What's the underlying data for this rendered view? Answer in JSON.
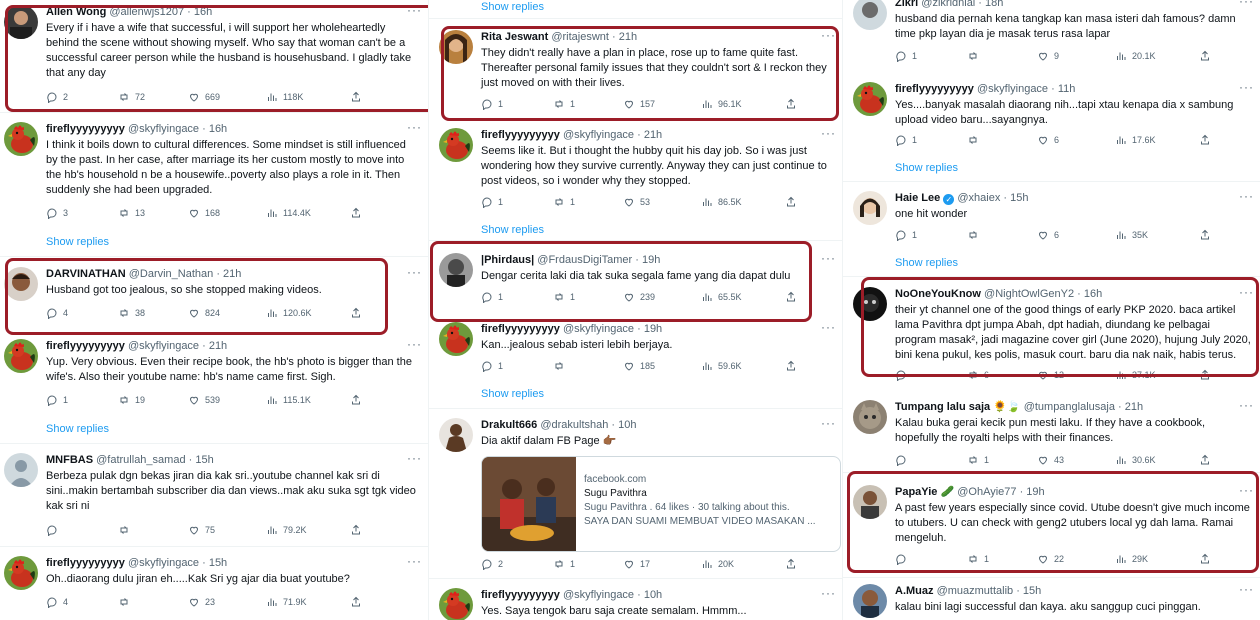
{
  "columns": [
    {
      "tweets": [
        {
          "name": "Allen Wong",
          "handle": "@allenwjs1207 · 16h",
          "text": "Every if i have a wife that successful, i will support her wholeheartedly behind the scene without showing myself. Who say that woman can't be a successful career person while the husband is househusband. I gladly take that any day",
          "replies": "2",
          "retweets": "72",
          "likes": "669",
          "views": "118K"
        },
        {
          "name": "fireflyyyyyyyyy",
          "handle": "@skyflyingace · 16h",
          "text": "I think it boils down to cultural differences. Some mindset is still influenced by the past. In her case, after marriage its her custom mostly to move into the hb's household n be a housewife..poverty also plays a role in it. Then suddenly she had been upgraded.",
          "replies": "3",
          "retweets": "13",
          "likes": "168",
          "views": "114.4K",
          "show_replies": "Show replies"
        },
        {
          "name": "DARVINATHAN",
          "handle": "@Darvin_Nathan · 21h",
          "text": "Husband got too jealous, so she stopped making videos.",
          "replies": "4",
          "retweets": "38",
          "likes": "824",
          "views": "120.6K"
        },
        {
          "name": "fireflyyyyyyyyy",
          "handle": "@skyflyingace · 21h",
          "text": "Yup. Very obvious. Even their recipe book, the hb's photo is bigger than the wife's. Also their youtube name: hb's name came first. Sigh.",
          "replies": "1",
          "retweets": "19",
          "likes": "539",
          "views": "115.1K",
          "show_replies": "Show replies"
        },
        {
          "name": "MNFBAS",
          "handle": "@fatrullah_samad · 15h",
          "text": "Berbeza pulak dgn bekas jiran dia kak sri..youtube channel kak sri di sini..makin bertambah subscriber dia dan views..mak aku suka sgt tgk video kak sri ni",
          "replies": "",
          "retweets": "",
          "likes": "75",
          "views": "79.2K"
        },
        {
          "name": "fireflyyyyyyyyy",
          "handle": "@skyflyingace · 15h",
          "text": "Oh..diaorang dulu jiran eh.....Kak Sri yg ajar dia buat youtube?",
          "replies": "4",
          "retweets": "",
          "likes": "23",
          "views": "71.9K"
        }
      ]
    },
    {
      "top_show_replies": "Show replies",
      "tweets": [
        {
          "name": "Rita Jeswant",
          "handle": "@ritajeswnt · 21h",
          "text": "They didn't really have a plan in place, rose up to fame quite fast. Thereafter personal family issues that they couldn't sort & I reckon they just moved on with their lives.",
          "replies": "1",
          "retweets": "1",
          "likes": "157",
          "views": "96.1K"
        },
        {
          "name": "fireflyyyyyyyyy",
          "handle": "@skyflyingace · 21h",
          "text": "Seems like it. But i thought the hubby quit his day job. So i was just wondering how they survive currently. Anyway they can just continue to post videos, so i wonder why they stopped.",
          "replies": "1",
          "retweets": "1",
          "likes": "53",
          "views": "86.5K",
          "show_replies": "Show replies"
        },
        {
          "name": "|Phirdaus|",
          "handle": "@FrdausDigiTamer · 19h",
          "text": "Dengar cerita laki dia tak suka segala fame yang dia dapat dulu",
          "replies": "1",
          "retweets": "1",
          "likes": "239",
          "views": "65.5K"
        },
        {
          "name": "fireflyyyyyyyyy",
          "handle": "@skyflyingace · 19h",
          "text": "Kan...jealous sebab isteri lebih berjaya.",
          "replies": "1",
          "retweets": "",
          "likes": "185",
          "views": "59.6K",
          "show_replies": "Show replies"
        },
        {
          "name": "Drakult666",
          "handle": "@drakultshah · 10h",
          "text": "Dia aktif dalam FB Page 👉🏾",
          "replies": "2",
          "retweets": "1",
          "likes": "17",
          "views": "20K",
          "card": {
            "domain": "facebook.com",
            "title": "Sugu Pavithra",
            "meta": "Sugu Pavithra . 64 likes · 30 talking about this.",
            "desc": "SAYA DAN SUAMI MEMBUAT VIDEO MASAKAN ..."
          }
        },
        {
          "name": "fireflyyyyyyyyy",
          "handle": "@skyflyingace · 10h",
          "text": "Yes. Saya tengok baru saja create semalam. Hmmm..."
        }
      ]
    },
    {
      "tweets": [
        {
          "name": "Zikri",
          "handle": "@zikridnial · 18h",
          "text": "husband dia pernah kena tangkap kan masa isteri dah famous? damn time pkp layan dia je masak terus rasa lapar",
          "replies": "1",
          "retweets": "",
          "likes": "9",
          "views": "20.1K"
        },
        {
          "name": "fireflyyyyyyyyy",
          "handle": "@skyflyingace · 11h",
          "text": "Yes....banyak masalah diaorang nih...tapi xtau kenapa dia x sambung upload video baru...sayangnya.",
          "replies": "1",
          "retweets": "",
          "likes": "6",
          "views": "17.6K",
          "show_replies": "Show replies"
        },
        {
          "name": "Haie Lee",
          "handle": "@xhaiex · 15h",
          "text": "one hit wonder",
          "replies": "1",
          "retweets": "",
          "likes": "6",
          "views": "35K",
          "show_replies": "Show replies"
        },
        {
          "name": "NoOneYouKnow",
          "handle": "@NightOwlGenY2 · 16h",
          "text": "their yt channel one of the good things of early PKP 2020. baca artikel lama Pavithra dpt jumpa Abah, dpt hadiah, diundang ke pelbagai program masak², jadi magazine cover girl (June 2020), hujung July 2020, bini kena pukul, kes polis, masuk court. baru dia nak naik, habis terus.",
          "replies": "",
          "retweets": "6",
          "likes": "12",
          "views": "37.1K"
        },
        {
          "name": "Tumpang lalu saja",
          "handle": "@tumpanglalusaja · 21h",
          "text": "Kalau buka gerai kecik pun mesti laku. If they have a cookbook, hopefully the royalti helps with their finances.",
          "replies": "",
          "retweets": "1",
          "likes": "43",
          "views": "30.6K"
        },
        {
          "name": "PapaYie",
          "handle": "@OhAyie77 · 19h",
          "text": "A past few years especially since covid. Utube doesn't give much income to utubers. U can check with geng2 utubers local yg dah lama. Ramai mengeluh.",
          "replies": "",
          "retweets": "1",
          "likes": "22",
          "views": "29K"
        },
        {
          "name": "A.Muaz",
          "handle": "@muazmuttalib · 15h",
          "text": "kalau bini lagi successful dan kaya. aku sanggup cuci pinggan."
        }
      ]
    }
  ],
  "colors": {
    "accent": "#1d9bf0",
    "highlight": "#9c1d28",
    "muted": "#536471"
  }
}
